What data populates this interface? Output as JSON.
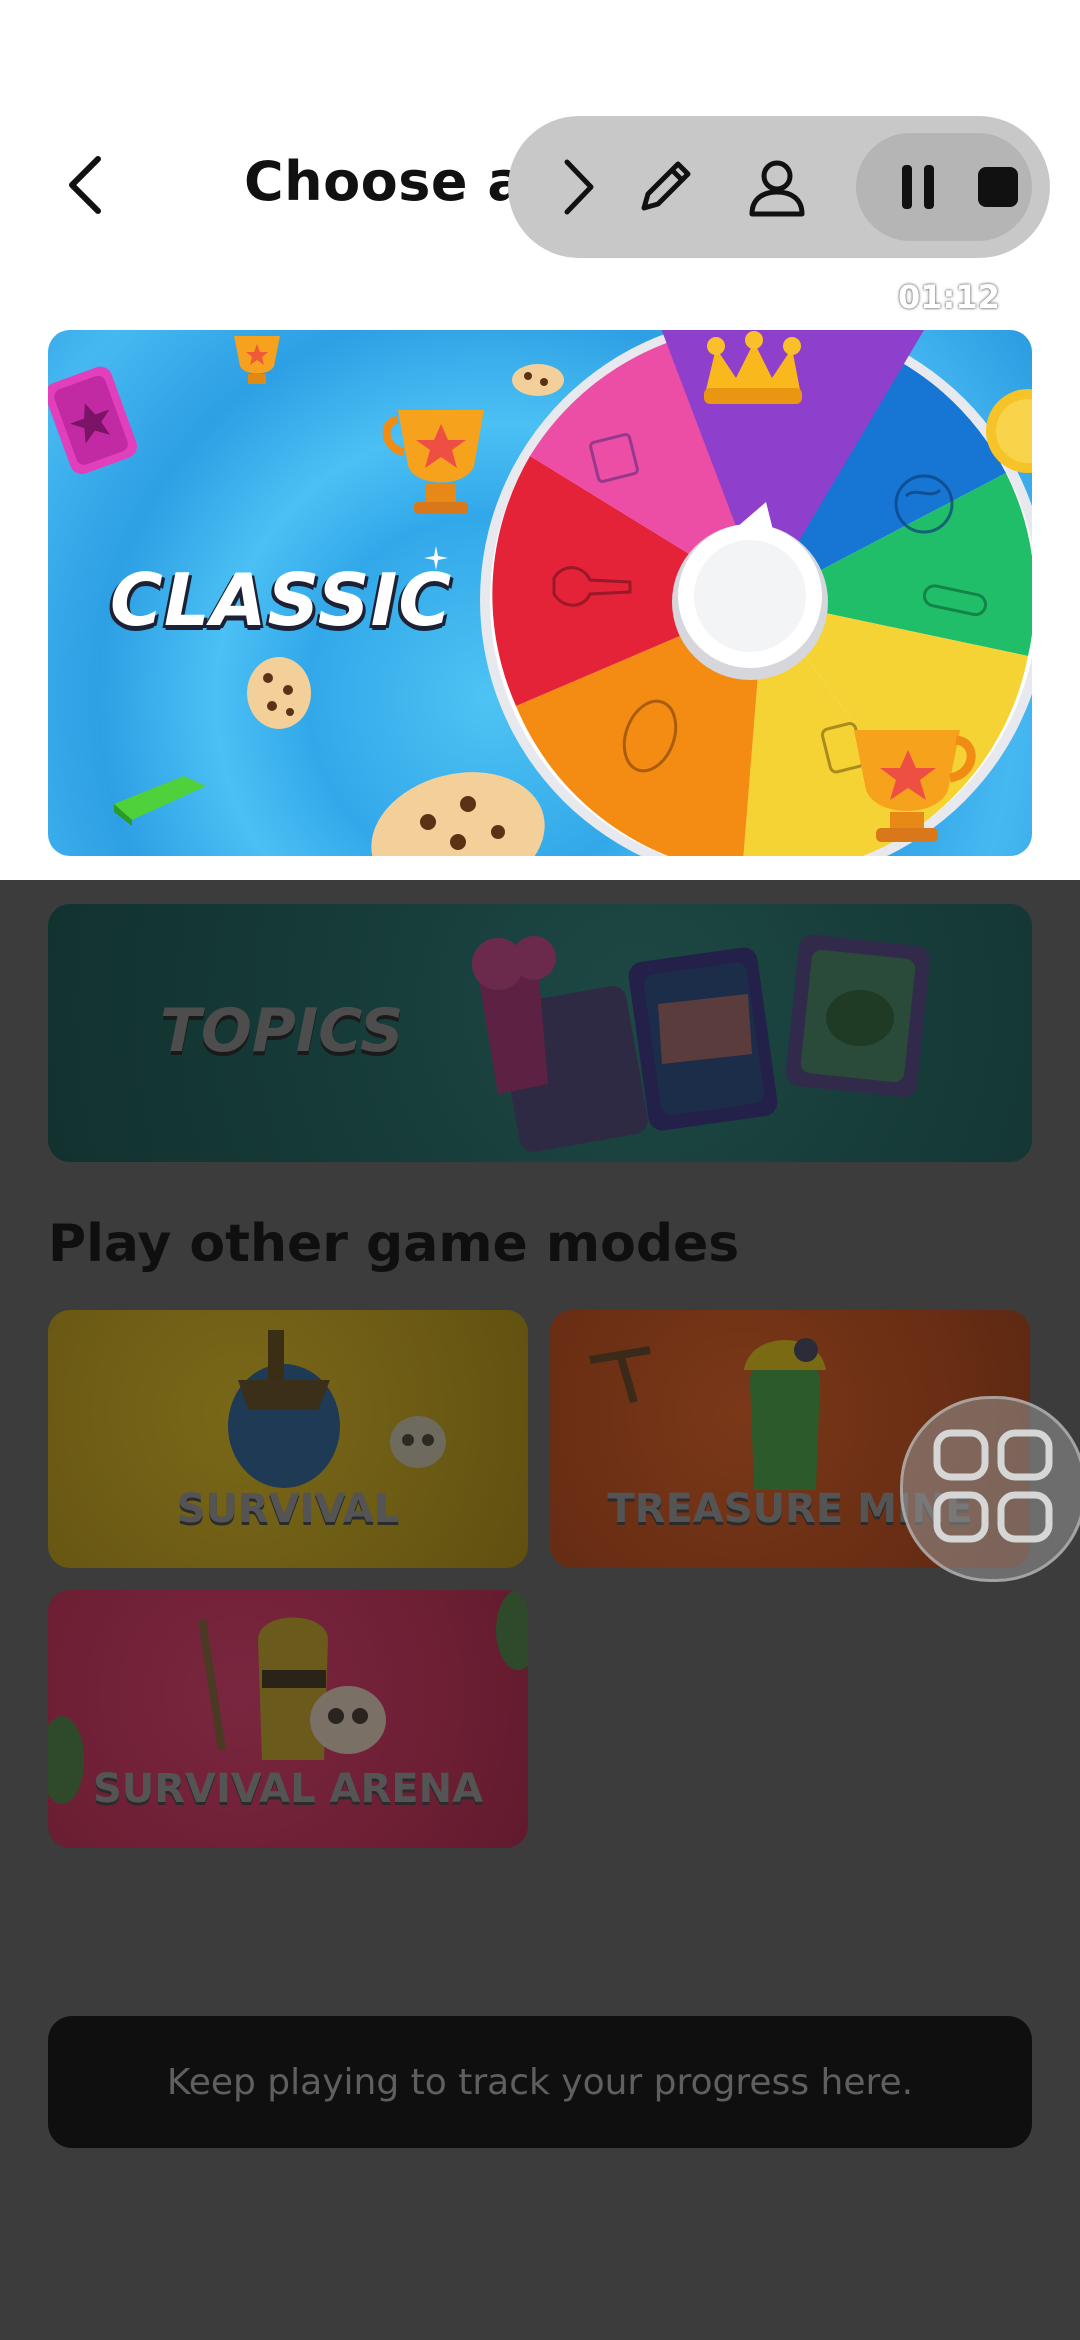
{
  "header": {
    "title": "Choose a game mode",
    "back_icon": "chevron-left-icon"
  },
  "recorder": {
    "icons": [
      "chevron-right-icon",
      "pencil-icon",
      "person-icon",
      "pause-icon",
      "stop-icon"
    ],
    "timer": "01:12"
  },
  "modes": {
    "classic": {
      "label": "CLASSIC",
      "accent": "#36aef0"
    },
    "topics": {
      "label": "TOPICS",
      "accent": "#163b38"
    }
  },
  "other_modes": {
    "title": "Play other game modes",
    "items": [
      {
        "label": "SURVIVAL",
        "color": "#6b5a14"
      },
      {
        "label": "TREASURE MINE",
        "color": "#6a2e14"
      },
      {
        "label": "SURVIVAL ARENA",
        "color": "#6e1f34"
      }
    ]
  },
  "progress": {
    "message": "Keep playing to track your progress here."
  },
  "float_button": {
    "icon": "grid-icon"
  }
}
